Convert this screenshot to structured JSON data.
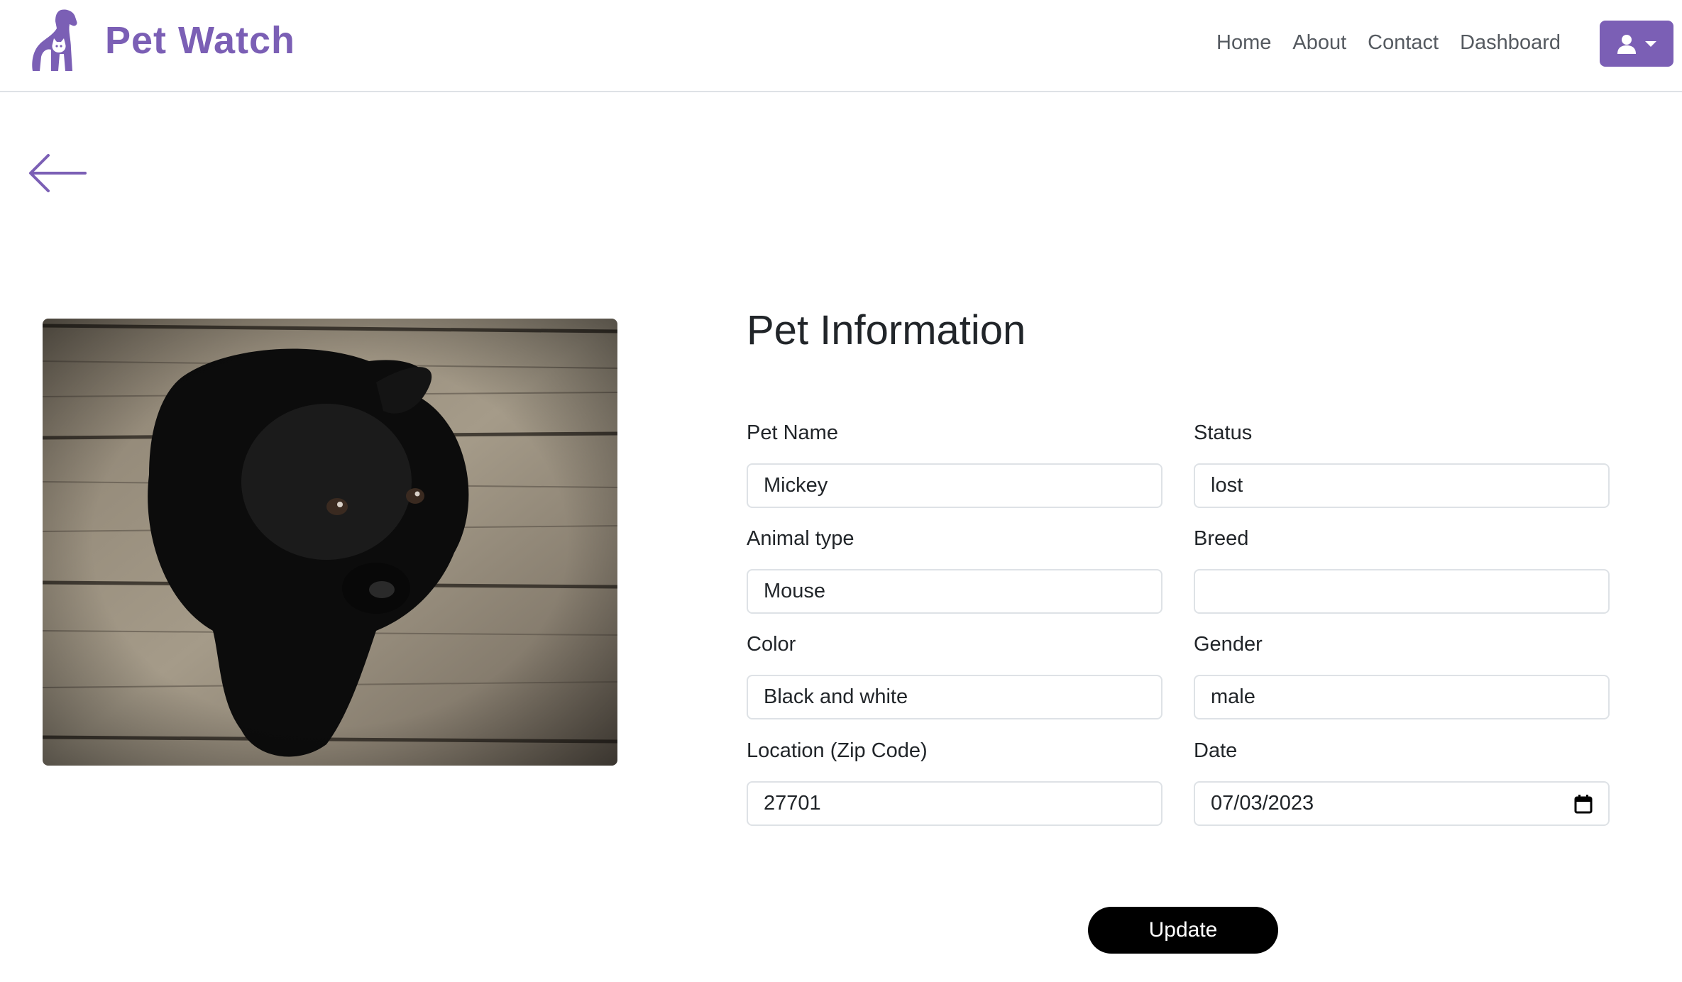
{
  "brand": {
    "name": "Pet Watch"
  },
  "nav": {
    "links": [
      "Home",
      "About",
      "Contact",
      "Dashboard"
    ]
  },
  "colors": {
    "accent": "#7b5fb5",
    "button": "#000000",
    "border": "#dee2e6"
  },
  "icons": {
    "back": "arrow-left-icon",
    "user": "user-icon",
    "caret": "caret-down-icon",
    "calendar": "calendar-icon"
  },
  "form": {
    "title": "Pet Information",
    "fields": {
      "pet_name": {
        "label": "Pet Name",
        "value": "Mickey"
      },
      "status": {
        "label": "Status",
        "value": "lost"
      },
      "animal_type": {
        "label": "Animal type",
        "value": "Mouse"
      },
      "breed": {
        "label": "Breed",
        "value": ""
      },
      "color": {
        "label": "Color",
        "value": "Black and white"
      },
      "gender": {
        "label": "Gender",
        "value": "male"
      },
      "location": {
        "label": "Location (Zip Code)",
        "value": "27701"
      },
      "date": {
        "label": "Date",
        "value": "07/03/2023"
      }
    },
    "submit_label": "Update"
  }
}
